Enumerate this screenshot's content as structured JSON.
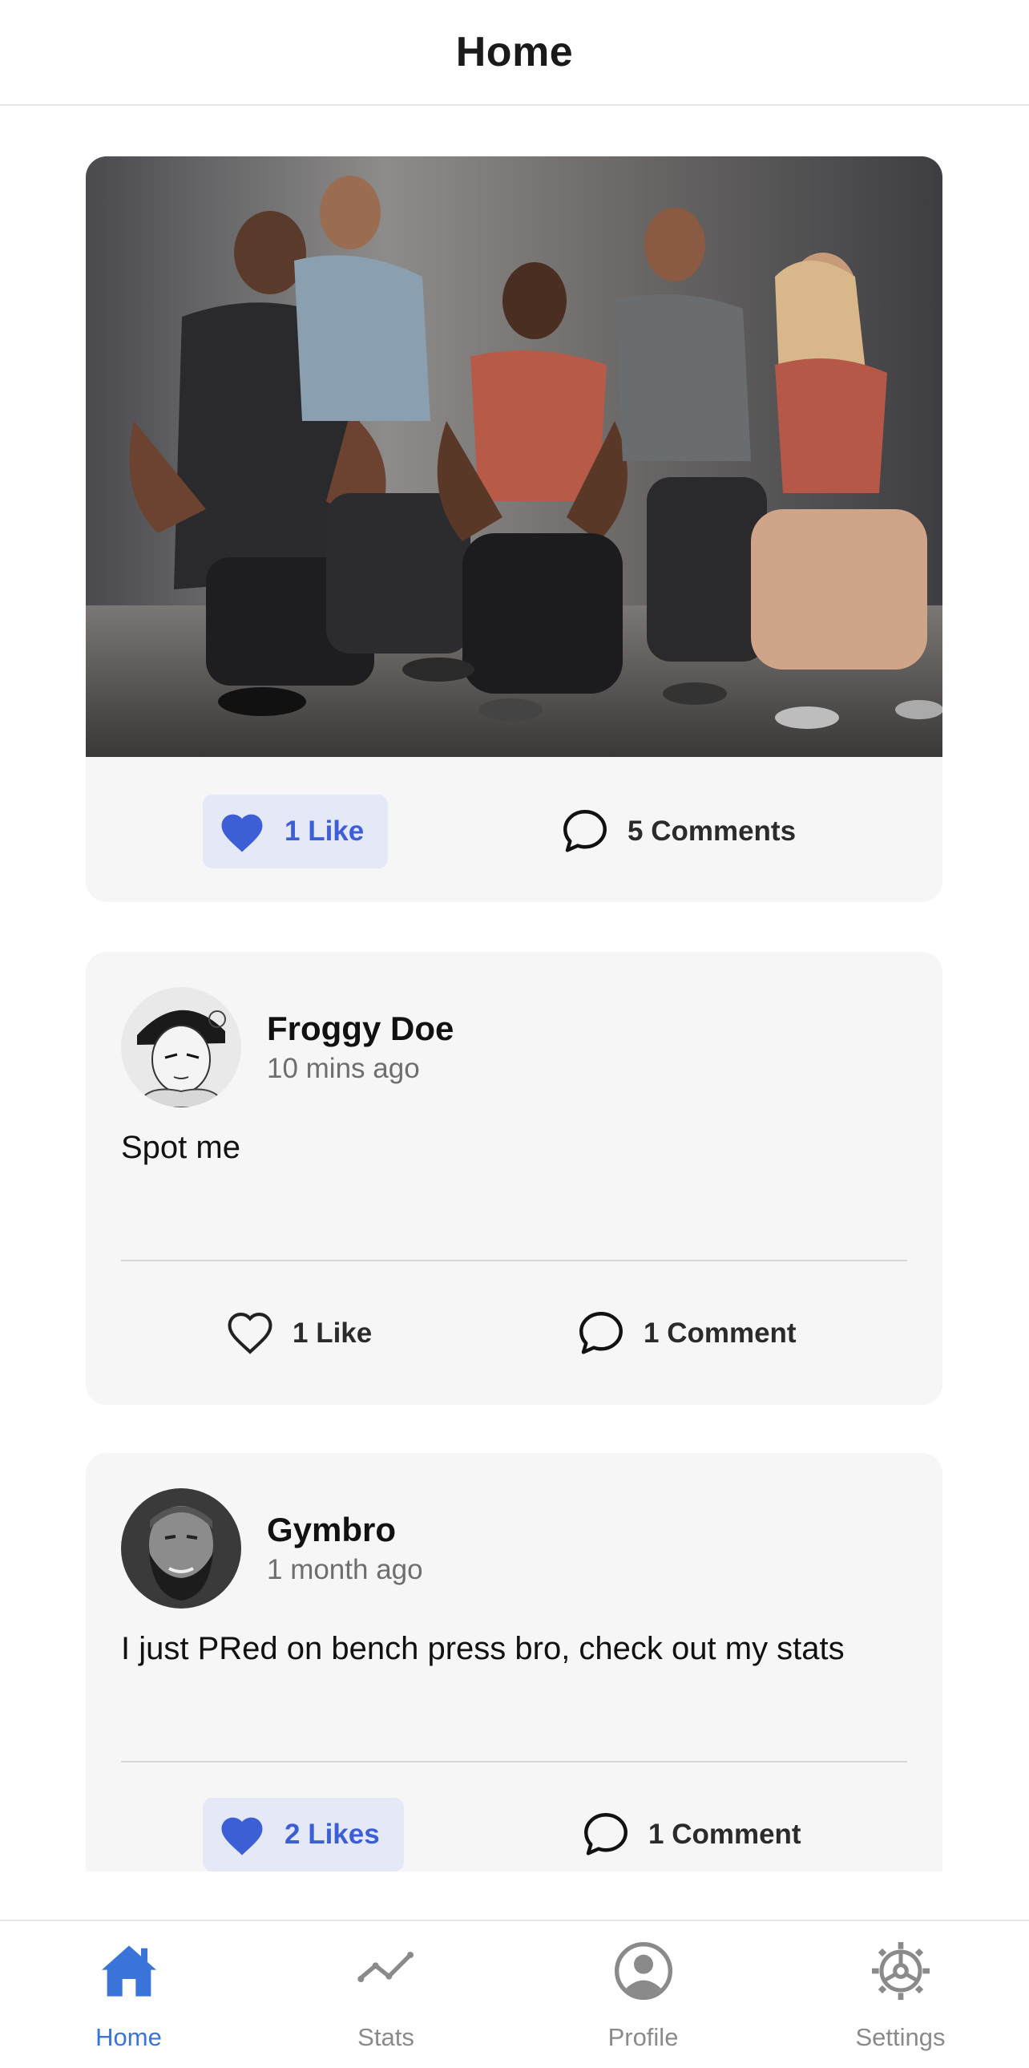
{
  "colors": {
    "accent": "#3b74d9",
    "liked": "#3d5fd6",
    "liked_bg": "#e4e8f7",
    "card_bg": "#f6f6f6",
    "muted": "#8a8a8a"
  },
  "header": {
    "title": "Home"
  },
  "posts": [
    {
      "type": "photo",
      "image": "group-fitness-photo",
      "like_label": "1 Like",
      "liked": true,
      "comment_label": "5 Comments"
    },
    {
      "type": "text",
      "author": "Froggy Doe",
      "time": "10 mins ago",
      "avatar": "manga-avatar",
      "text": "Spot me",
      "like_label": "1 Like",
      "liked": false,
      "comment_label": "1 Comment"
    },
    {
      "type": "text",
      "author": "Gymbro",
      "time": "1 month ago",
      "avatar": "bearded-man-avatar",
      "text": "I just PRed on bench press bro, check out my stats",
      "like_label": "2 Likes",
      "liked": true,
      "comment_label": "1 Comment"
    }
  ],
  "tabbar": {
    "active": "home",
    "items": [
      {
        "id": "home",
        "label": "Home",
        "icon": "house-icon"
      },
      {
        "id": "stats",
        "label": "Stats",
        "icon": "line-graph-icon"
      },
      {
        "id": "profile",
        "label": "Profile",
        "icon": "user-circle-icon"
      },
      {
        "id": "settings",
        "label": "Settings",
        "icon": "gear-icon"
      }
    ]
  }
}
